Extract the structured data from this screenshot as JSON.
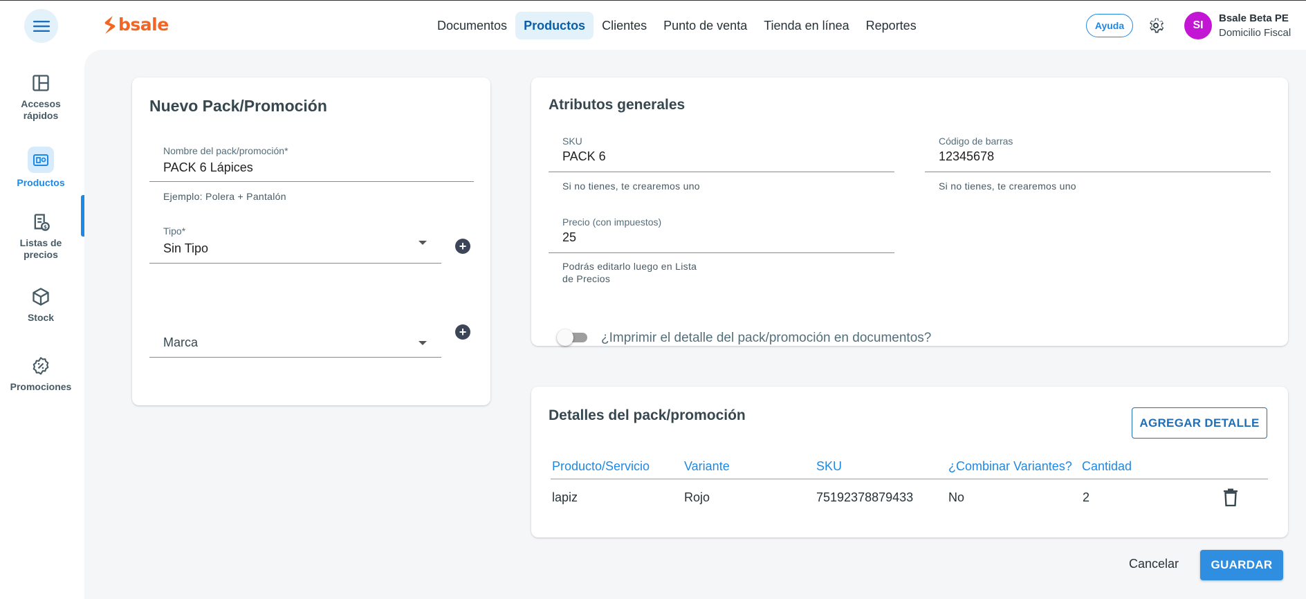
{
  "brand": {
    "name": "bsale",
    "color": "#f26522"
  },
  "topnav": {
    "items": [
      {
        "label": "Documentos"
      },
      {
        "label": "Productos"
      },
      {
        "label": "Clientes"
      },
      {
        "label": "Punto de venta"
      },
      {
        "label": "Tienda en línea"
      },
      {
        "label": "Reportes"
      }
    ],
    "active": "Productos"
  },
  "header": {
    "help_label": "Ayuda",
    "avatar_initials": "SI",
    "user_name": "Bsale Beta PE",
    "user_sub": "Domicilio Fiscal",
    "accent": "#1e88e5",
    "avatar_color": "#c316d4"
  },
  "sidebar": {
    "items": [
      {
        "label1": "Accesos",
        "label2": "rápidos",
        "icon": "layout-icon"
      },
      {
        "label1": "Productos",
        "label2": "",
        "icon": "products-icon",
        "active": true
      },
      {
        "label1": "Listas de",
        "label2": "precios",
        "icon": "price-list-icon"
      },
      {
        "label1": "Stock",
        "label2": "",
        "icon": "box-icon"
      },
      {
        "label1": "Promociones",
        "label2": "",
        "icon": "discount-icon"
      }
    ]
  },
  "pack_form": {
    "title": "Nuevo Pack/Promoción",
    "name_label": "Nombre del pack/promoción*",
    "name_value": "PACK 6 Lápices",
    "name_hint": "Ejemplo: Polera + Pantalón",
    "type_label": "Tipo*",
    "type_value": "Sin Tipo",
    "brand_placeholder": "Marca"
  },
  "attributes": {
    "title": "Atributos generales",
    "sku_label": "SKU",
    "sku_value": "PACK 6",
    "sku_hint": "Si no tienes, te crearemos uno",
    "barcode_label": "Código de barras",
    "barcode_value": "12345678",
    "barcode_hint": "Si no tienes, te crearemos uno",
    "price_label": "Precio (con impuestos)",
    "price_value": "25",
    "price_hint_1": "Podrás editarlo luego en Lista",
    "price_hint_2": "de Precios",
    "print_toggle_label": "¿Imprimir el detalle del pack/promoción en documentos?",
    "print_toggle_on": false
  },
  "details": {
    "title": "Detalles del pack/promoción",
    "add_button": "AGREGAR DETALLE",
    "columns": [
      "Producto/Servicio",
      "Variante",
      "SKU",
      "¿Combinar Variantes?",
      "Cantidad"
    ],
    "rows": [
      {
        "product": "lapiz",
        "variant": "Rojo",
        "sku": "75192378879433",
        "combine": "No",
        "qty": "2"
      }
    ]
  },
  "actions": {
    "cancel": "Cancelar",
    "save": "GUARDAR"
  }
}
